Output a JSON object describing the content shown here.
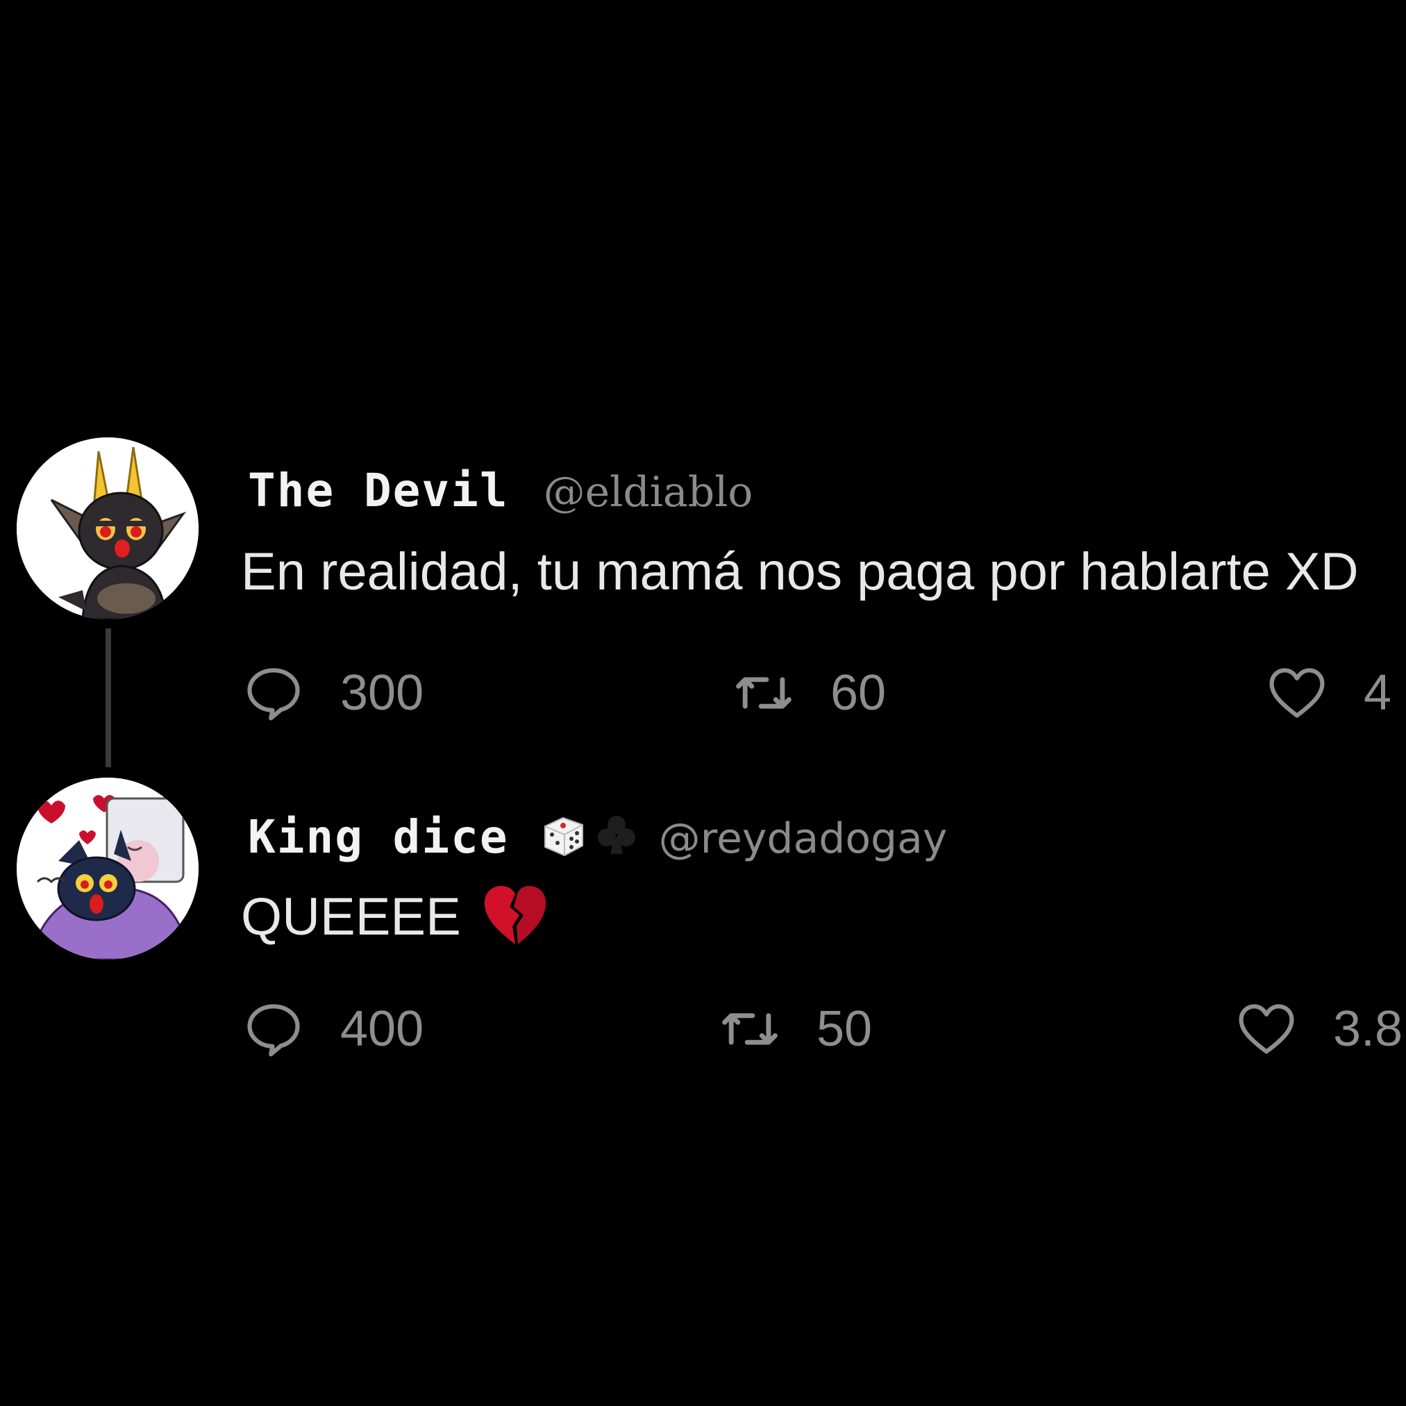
{
  "colors": {
    "background": "#000000",
    "name_text": "#f2f2f2",
    "body_text": "#e8e8e8",
    "muted_text": "#8e8e8e",
    "thread_line": "#3a3b3c"
  },
  "tweets": [
    {
      "display_name": "The Devil",
      "handle": "@eldiablo",
      "avatar_icon": "devil-avatar",
      "badges": [],
      "text": "En realidad, tu mamá nos paga por hablarte XD",
      "text_emoji": "",
      "replies": "300",
      "retweets": "60",
      "likes": "4"
    },
    {
      "display_name": "King dice",
      "handle": "@reydadogay",
      "avatar_icon": "king-dice-avatar",
      "badges": [
        "die-emoji",
        "club-suit-emoji"
      ],
      "text": "QUEEEE",
      "text_emoji": "broken-heart-emoji",
      "replies": "400",
      "retweets": "50",
      "likes": "3.8"
    }
  ],
  "icons": {
    "reply": "speech-bubble-icon",
    "retweet": "retweet-icon",
    "like": "heart-icon"
  }
}
